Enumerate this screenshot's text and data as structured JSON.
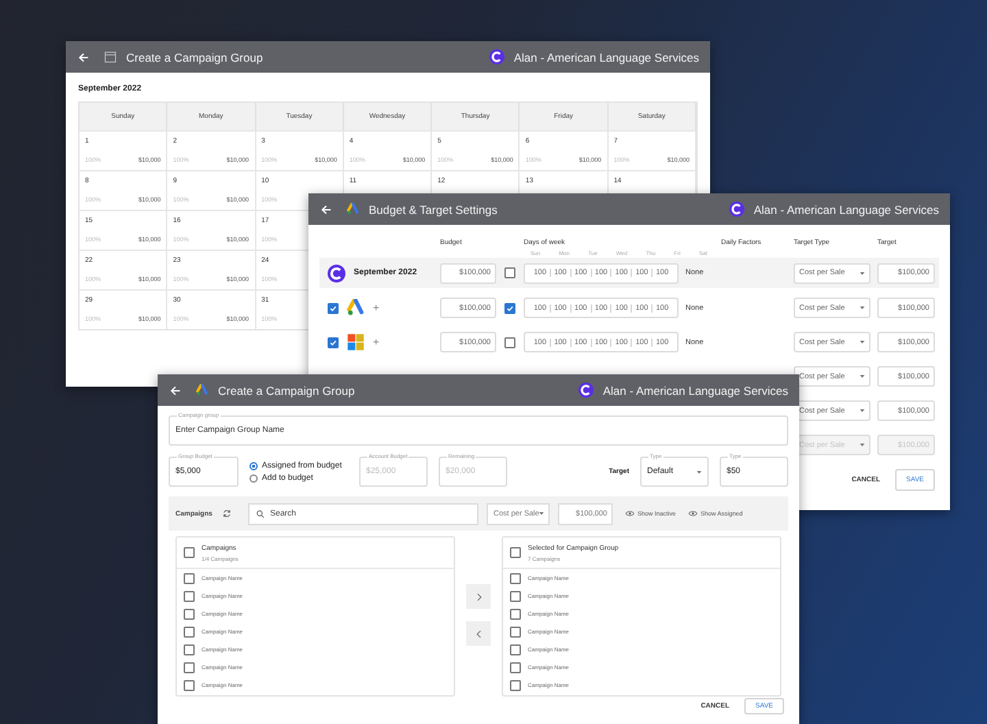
{
  "calendar_window": {
    "title": "Create a Campaign Group",
    "account": "Alan - American Language Services",
    "month": "September 2022",
    "weekdays": [
      "Sunday",
      "Monday",
      "Tuesday",
      "Wednesday",
      "Thursday",
      "Friday",
      "Saturday"
    ],
    "weeks": [
      [
        {
          "day": "1",
          "factor": "100%",
          "amount": "$10,000"
        },
        {
          "day": "2",
          "factor": "100%",
          "amount": "$10,000"
        },
        {
          "day": "3",
          "factor": "100%",
          "amount": "$10,000"
        },
        {
          "day": "4",
          "factor": "100%",
          "amount": "$10,000"
        },
        {
          "day": "5",
          "factor": "100%",
          "amount": "$10,000"
        },
        {
          "day": "6",
          "factor": "100%",
          "amount": "$10,000"
        },
        {
          "day": "7",
          "factor": "100%",
          "amount": "$10,000"
        }
      ],
      [
        {
          "day": "8",
          "factor": "100%",
          "amount": "$10,000"
        },
        {
          "day": "9",
          "factor": "100%",
          "amount": "$10,000"
        },
        {
          "day": "10",
          "factor": "100%"
        },
        {
          "day": "11"
        },
        {
          "day": "12"
        },
        {
          "day": "13"
        },
        {
          "day": "14"
        }
      ],
      [
        {
          "day": "15",
          "factor": "100%",
          "amount": "$10,000"
        },
        {
          "day": "16",
          "factor": "100%",
          "amount": "$10,000"
        },
        {
          "day": "17",
          "factor": "100%"
        }
      ],
      [
        {
          "day": "22",
          "factor": "100%",
          "amount": "$10,000"
        },
        {
          "day": "23",
          "factor": "100%",
          "amount": "$10,000"
        },
        {
          "day": "24",
          "factor": "100%"
        }
      ],
      [
        {
          "day": "29",
          "factor": "100%",
          "amount": "$10,000"
        },
        {
          "day": "30",
          "factor": "100%",
          "amount": "$10,000"
        },
        {
          "day": "31",
          "factor": "100%"
        }
      ]
    ]
  },
  "budget_window": {
    "title": "Budget & Target Settings",
    "account": "Alan - American Language Services",
    "columns": {
      "budget": "Budget",
      "days": "Days of week",
      "daily_factors": "Daily Factors",
      "target_type": "Target Type",
      "target": "Target"
    },
    "weekdays": [
      "Sun",
      "Mon",
      "Tue",
      "Wed",
      "Thu",
      "Fri",
      "Sat"
    ],
    "rows": [
      {
        "kind": "month",
        "label": "September 2022",
        "budget": "$100,000",
        "days_checked": false,
        "day_values": [
          "100",
          "100",
          "100",
          "100",
          "100",
          "100",
          "100"
        ],
        "daily_factors": "None",
        "target_type": "Cost per Sale",
        "target": "$100,000",
        "disabled": false
      },
      {
        "kind": "ads",
        "checked": true,
        "plus": "+",
        "budget": "$100,000",
        "days_checked": true,
        "day_values": [
          "100",
          "100",
          "100",
          "100",
          "100",
          "100",
          "100"
        ],
        "daily_factors": "None",
        "target_type": "Cost per Sale",
        "target": "$100,000",
        "disabled": false
      },
      {
        "kind": "squares",
        "checked": true,
        "plus": "+",
        "budget": "$100,000",
        "days_checked": false,
        "day_values": [
          "100",
          "100",
          "100",
          "100",
          "100",
          "100",
          "100"
        ],
        "daily_factors": "None",
        "target_type": "Cost per Sale",
        "target": "$100,000",
        "disabled": false
      },
      {
        "kind": "covered",
        "target_type": "Cost per Sale",
        "target": "$100,000",
        "disabled": false
      },
      {
        "kind": "covered",
        "target_type": "Cost per Sale",
        "target": "$100,000",
        "disabled": false
      },
      {
        "kind": "covered",
        "target_type": "Cost per Sale",
        "target": "$100,000",
        "disabled": true
      }
    ],
    "cancel": "CANCEL",
    "save": "SAVE"
  },
  "group_window": {
    "title": "Create a Campaign Group",
    "account": "Alan - American Language Services",
    "campaign_group": {
      "label": "Campaign group",
      "placeholder": "Enter Campaign Group Name"
    },
    "group_budget": {
      "label": "Group Budget",
      "value": "$5,000"
    },
    "budget_modes": [
      {
        "label": "Assigned from budget",
        "selected": true
      },
      {
        "label": "Add to budget",
        "selected": false
      }
    ],
    "account_budget": {
      "label": "Account Budget",
      "value": "$25,000",
      "disabled": true
    },
    "remaining": {
      "label": "Remaining",
      "value": "$20,000",
      "disabled": true
    },
    "target_label": "Target",
    "target_type": {
      "label": "Type",
      "value": "Default"
    },
    "target_value": {
      "label": "Type",
      "value": "$50"
    },
    "toolbar": {
      "label": "Campaigns",
      "search_placeholder": "Search",
      "metric": "Cost per Sale",
      "amount": "$100,000",
      "toggles": [
        "Show Inactive",
        "Show Assigned"
      ]
    },
    "available": {
      "title": "Campaigns",
      "count": "1/4 Campaigns",
      "checked": false,
      "items": [
        {
          "name": "Campaign Name",
          "checked": false
        },
        {
          "name": "Campaign Name",
          "checked": false
        },
        {
          "name": "Campaign Name",
          "checked": false
        },
        {
          "name": "Campaign Name",
          "checked": false
        },
        {
          "name": "Campaign Name",
          "checked": false
        },
        {
          "name": "Campaign Name",
          "checked": false
        },
        {
          "name": "Campaign Name",
          "checked": false
        }
      ]
    },
    "chosen": {
      "title": "Selected for Campaign Group",
      "count": "7 Campaigns",
      "checked": false,
      "items": [
        {
          "name": "Campaign Name",
          "checked": false
        },
        {
          "name": "Campaign Name",
          "checked": false
        },
        {
          "name": "Campaign Name",
          "checked": false
        },
        {
          "name": "Campaign Name",
          "checked": false
        },
        {
          "name": "Campaign Name",
          "checked": false
        },
        {
          "name": "Campaign Name",
          "checked": false
        },
        {
          "name": "Campaign Name",
          "checked": false
        }
      ]
    },
    "cancel": "CANCEL",
    "save": "SAVE"
  }
}
